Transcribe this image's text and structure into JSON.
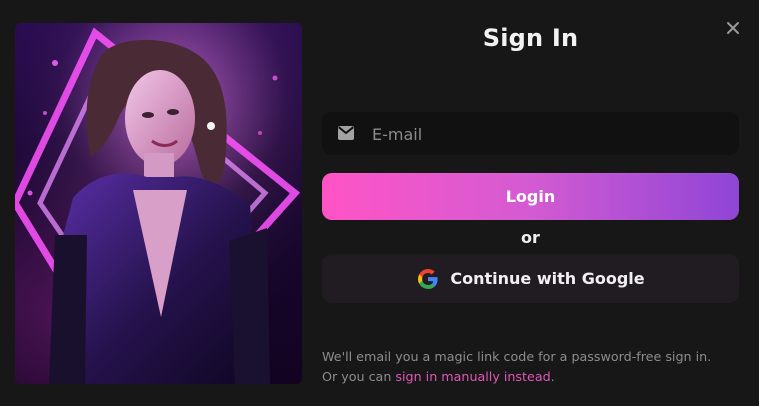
{
  "title": "Sign In",
  "email": {
    "placeholder": "E-mail",
    "value": "",
    "icon": "mail-icon"
  },
  "login_label": "Login",
  "or_label": "or",
  "google_label": "Continue with Google",
  "info": {
    "line1": "We'll email you a magic link code for a password-free sign in.",
    "line2_prefix": "Or you can",
    "link_text": "sign in manually instead",
    "line2_suffix": "."
  },
  "colors": {
    "background": "#171717",
    "accent_gradient_start": "#ff54c6",
    "accent_gradient_end": "#8f45d6",
    "link": "#e057b5"
  }
}
